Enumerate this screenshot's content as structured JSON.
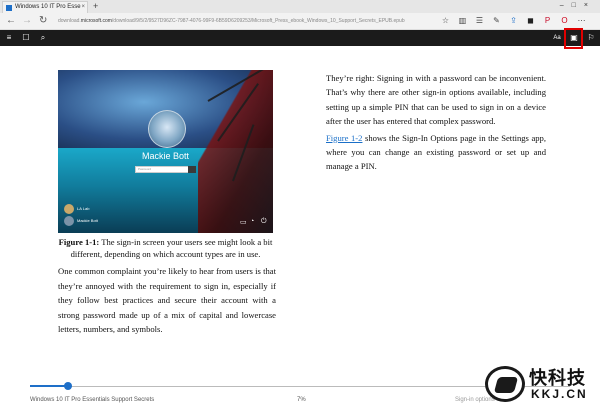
{
  "browser": {
    "tab_title": "Windows 10 IT Pro Esse",
    "tab_close": "×",
    "new_tab": "+",
    "window_controls": "–□×",
    "nav": {
      "back": "←",
      "forward": "→",
      "refresh": "↻"
    },
    "address_prefix": "download.",
    "address_domain": "microsoft.com",
    "address_path": "/download/9/5/2/9527D96ZC-7987-4076-99F9-6B59D6209253/Microsoft_Press_ebook_Windows_10_Support_Secrets_EPUB.epub"
  },
  "toolbar_icons": [
    "favorite-icon",
    "reading-view-icon",
    "hub-icon",
    "annotate-icon",
    "share-icon",
    "extension-icon",
    "pinterest-icon",
    "opera-icon",
    "more-icon"
  ],
  "toolbar_glyphs": [
    "☆",
    "▥",
    "☰",
    "✎",
    "⇪",
    "◼",
    "P",
    "O",
    "⋯"
  ],
  "reader_toolbar": {
    "menu": "≡",
    "pages": "☐",
    "search": "⌕",
    "text_options": "Aa",
    "reading_view": "▣",
    "bookmark": "⚐"
  },
  "figure": {
    "user_name": "Mackie Bott",
    "password_placeholder": "Password",
    "other_users": [
      "LA Lab",
      "Mackie Bott"
    ]
  },
  "caption": {
    "label": "Figure 1-1:",
    "text": " The sign-in screen your users see might look a bit different, depending on which account types are in use."
  },
  "body_left": "One common complaint you’re likely to hear from users is that they’re annoyed with the requirement to sign in, especially if they follow best practices and secure their account with a strong password made up of a mix of capital and lowercase letters, numbers, and symbols.",
  "body_right": {
    "p1": "They’re right: Signing in with a password can be inconvenient. That’s why there are other sign-in options available, including setting up a simple PIN that can be used to sign in on a device after the user has entered that complex password.",
    "p2_link": "Figure 1-2",
    "p2_text": " shows the Sign-In Options page in the Settings app, where you can change an existing password or set up and manage a PIN."
  },
  "footer": {
    "book_title": "Windows 10 IT Pro Essentials Support Secrets",
    "progress_label": "7%",
    "progress": 0.07,
    "location_hint": "Sign-in options"
  },
  "watermark": {
    "cn": "快科技",
    "en": "KKJ.CN"
  }
}
